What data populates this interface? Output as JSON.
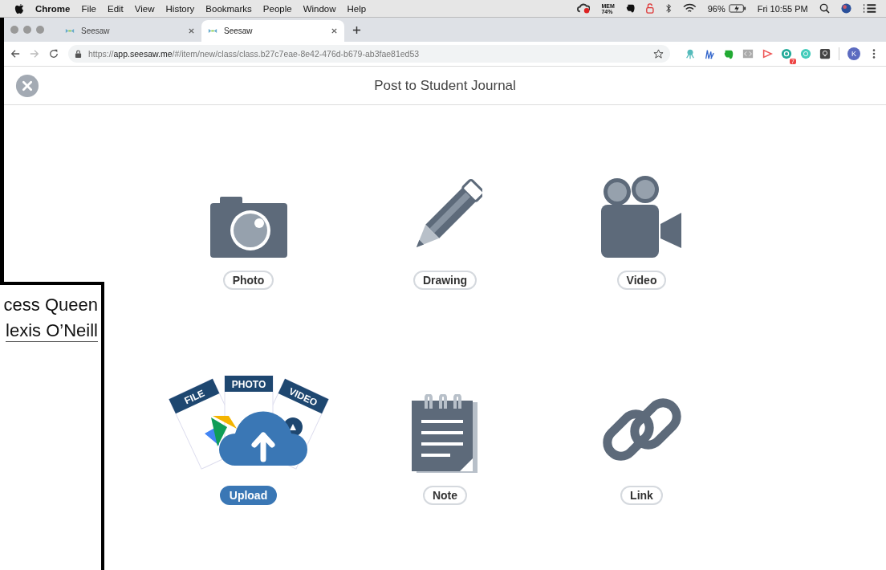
{
  "menu_bar": {
    "app": "Chrome",
    "items": [
      "File",
      "Edit",
      "View",
      "History",
      "Bookmarks",
      "People",
      "Window",
      "Help"
    ],
    "mem_label": "MEM",
    "mem_value": "74%",
    "battery": "96%",
    "clock": "Fri 10:55 PM"
  },
  "tabs": [
    {
      "title": "Seesaw",
      "selected": false
    },
    {
      "title": "Seesaw",
      "selected": true
    }
  ],
  "address_bar": {
    "url_prefix": "https://",
    "url_host": "app.seesaw.me",
    "url_path": "/#/item/new/class/class.b27c7eae-8e42-476d-b679-ab3fae81ed53"
  },
  "extensions": {
    "badge": "7",
    "profile": "K"
  },
  "page": {
    "title": "Post to Student Journal"
  },
  "options": [
    {
      "kind": "photo",
      "label": "Photo",
      "selected": false
    },
    {
      "kind": "drawing",
      "label": "Drawing",
      "selected": false
    },
    {
      "kind": "video",
      "label": "Video",
      "selected": false
    },
    {
      "kind": "upload",
      "label": "Upload",
      "selected": true,
      "tags": [
        "FILE",
        "PHOTO",
        "VIDEO"
      ]
    },
    {
      "kind": "note",
      "label": "Note",
      "selected": false
    },
    {
      "kind": "link",
      "label": "Link",
      "selected": false
    }
  ],
  "background_window": {
    "lines": [
      "cess Queen",
      "lexis O’Neill"
    ]
  }
}
